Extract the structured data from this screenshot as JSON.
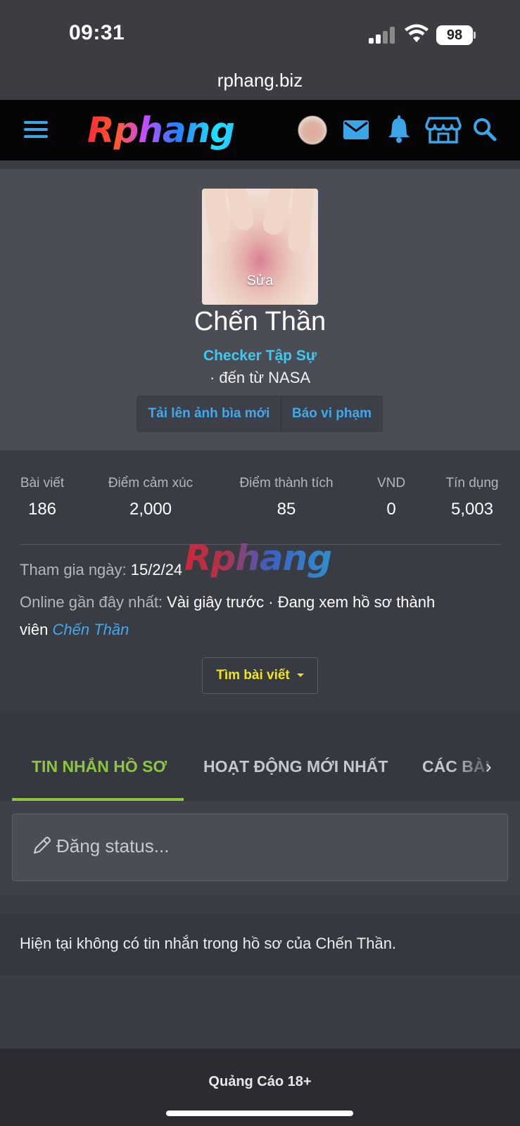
{
  "status_bar": {
    "time": "09:31",
    "battery": "98"
  },
  "browser": {
    "url": "rphang.biz"
  },
  "nav": {
    "logo": "Rphang",
    "icons": [
      "menu-icon",
      "avatar",
      "mail-icon",
      "bell-icon",
      "store-icon",
      "search-icon"
    ],
    "accent_color": "#3aa5e8"
  },
  "profile": {
    "edit_label": "Sửa",
    "name": "Chến Thần",
    "title": "Checker Tập Sự",
    "location": "· đến từ NASA",
    "buttons": {
      "upload_cover": "Tải lên ảnh bìa mới",
      "report": "Báo vi phạm"
    }
  },
  "stats": [
    {
      "label": "Bài viết",
      "value": "186"
    },
    {
      "label": "Điểm cảm xúc",
      "value": "2,000"
    },
    {
      "label": "Điểm thành tích",
      "value": "85"
    },
    {
      "label": "VND",
      "value": "0"
    },
    {
      "label": "Tín dụng",
      "value": "5,003"
    }
  ],
  "watermark": "Rphang",
  "info": {
    "joined_label": "Tham gia ngày:",
    "joined_value": "15/2/24",
    "online_label": "Online gần đây nhất:",
    "online_value": "Vài giây trước · Đang xem hồ sơ thành",
    "online_value_2": "viên",
    "online_link": "Chến Thần"
  },
  "find_posts": "Tìm bài viết",
  "tabs": [
    {
      "label": "TIN NHẮN HỒ SƠ",
      "active": true
    },
    {
      "label": "HOẠT ĐỘNG MỚI NHẤT",
      "active": false
    },
    {
      "label": "CÁC BÀI",
      "active": false
    }
  ],
  "tab_colors": {
    "active": "#8cc63f"
  },
  "status_post": {
    "placeholder": "Đăng status..."
  },
  "no_messages": "Hiện tại không có tin nhắn trong hồ sơ của Chến Thần.",
  "footer": {
    "ad": "Quảng Cáo 18+"
  }
}
